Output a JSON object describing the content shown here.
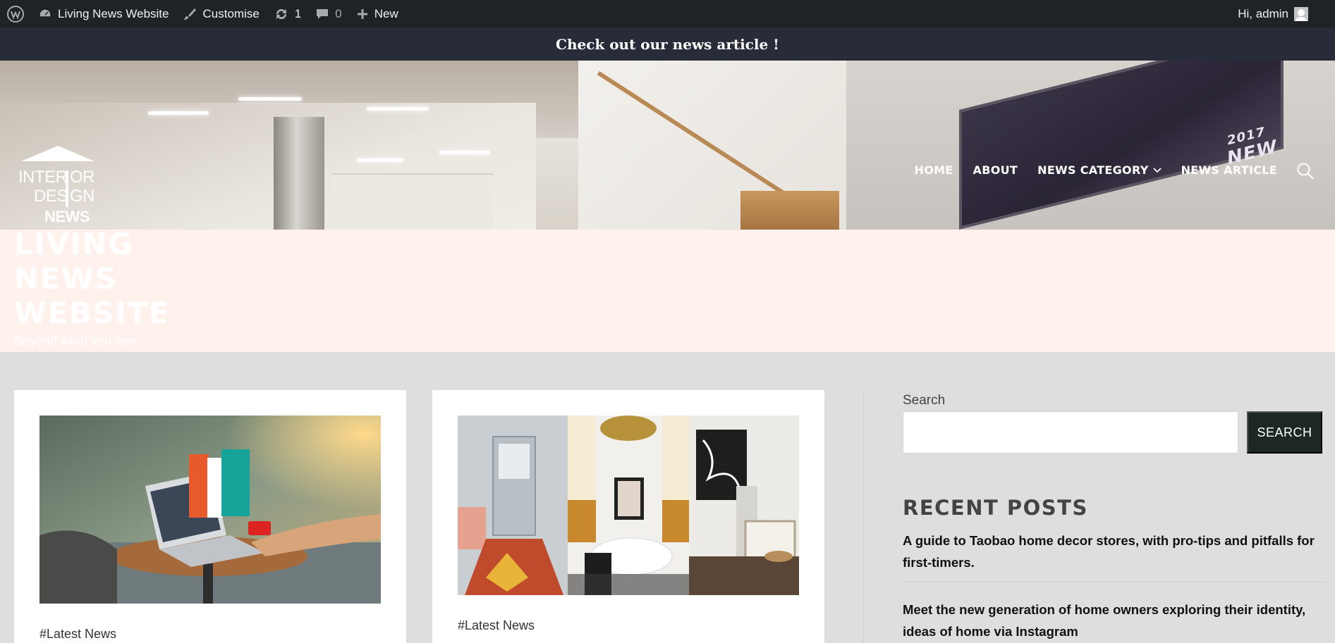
{
  "admin_bar": {
    "wp_icon": "wordpress-icon",
    "site_name": "Living News Website",
    "customise": "Customise",
    "updates_count": "1",
    "comments_count": "0",
    "new_label": "New",
    "greeting": "Hi, admin"
  },
  "announcement": "Check out our news article !",
  "header": {
    "logo_text": [
      "INTER",
      "OR",
      "DES",
      "GN",
      "NEWS"
    ],
    "nav": [
      {
        "label": "HOME"
      },
      {
        "label": "ABOUT"
      },
      {
        "label": "NEWS CATEGORY",
        "has_dropdown": true
      },
      {
        "label": "NEWS ARTICLE"
      }
    ],
    "search_icon": "search-icon",
    "hero_badge": [
      "2017",
      "NEW"
    ]
  },
  "site": {
    "title_lines": [
      "LIVING",
      "NEWS",
      "WEBSITE"
    ],
    "tagline": "Beyond what you see"
  },
  "posts": [
    {
      "category": "#Latest News"
    },
    {
      "category": "#Latest News"
    }
  ],
  "sidebar": {
    "search_label": "Search",
    "search_value": "",
    "search_button": "SEARCH",
    "recent_heading": "RECENT POSTS",
    "recent_posts": [
      "A guide to Taobao home decor stores, with pro-tips and pitfalls for first-timers.",
      "Meet the new generation of home owners exploring their identity, ideas of home via Instagram"
    ]
  },
  "colors": {
    "admin_bar_bg": "#1d2327",
    "announcement_bg": "#272c38",
    "title_band_bg": "#fff2ed",
    "page_bg": "#dedede",
    "search_button_bg": "#1d2723"
  }
}
